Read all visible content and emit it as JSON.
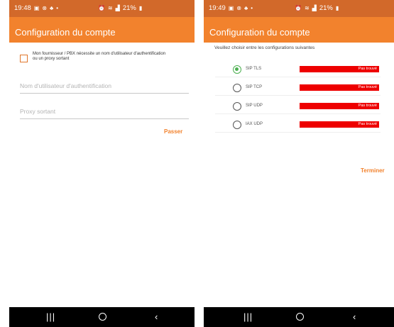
{
  "left_screen": {
    "status": {
      "time": "19:48",
      "battery": "21%"
    },
    "title": "Configuration du compte",
    "checkbox_label": "Mon fournisseur / PBX nécessite un nom d'utilisateur d'authentification ou un proxy sortant",
    "auth_username_placeholder": "Nom d'utilisateur d'authentification",
    "proxy_placeholder": "Proxy sortant",
    "skip_label": "Passer"
  },
  "right_screen": {
    "status": {
      "time": "19:49",
      "battery": "21%"
    },
    "title": "Configuration du compte",
    "instruction": "Veuillez choisir entre les configurations suivantes",
    "options": [
      {
        "label": "SIP TLS",
        "status": "Pas trouvé",
        "selected": true
      },
      {
        "label": "SIP TCP",
        "status": "Pas trouvé",
        "selected": false
      },
      {
        "label": "SIP UDP",
        "status": "Pas trouvé",
        "selected": false
      },
      {
        "label": "IAX UDP",
        "status": "Pas trouvé",
        "selected": false
      }
    ],
    "finish_label": "Terminer"
  },
  "colors": {
    "status_bar": "#d2692a",
    "app_bar": "#f2822d",
    "accent": "#f2822d",
    "error": "#ee0000",
    "radio_selected": "#4caf50"
  },
  "icons": {
    "status_left": [
      "image-icon",
      "cancel-circle-icon",
      "notification-icon",
      "dot-icon"
    ],
    "status_right": [
      "alarm-icon",
      "wifi-icon",
      "signal-icon",
      "battery-icon"
    ],
    "nav": [
      "recents-icon",
      "home-icon",
      "back-icon"
    ]
  }
}
